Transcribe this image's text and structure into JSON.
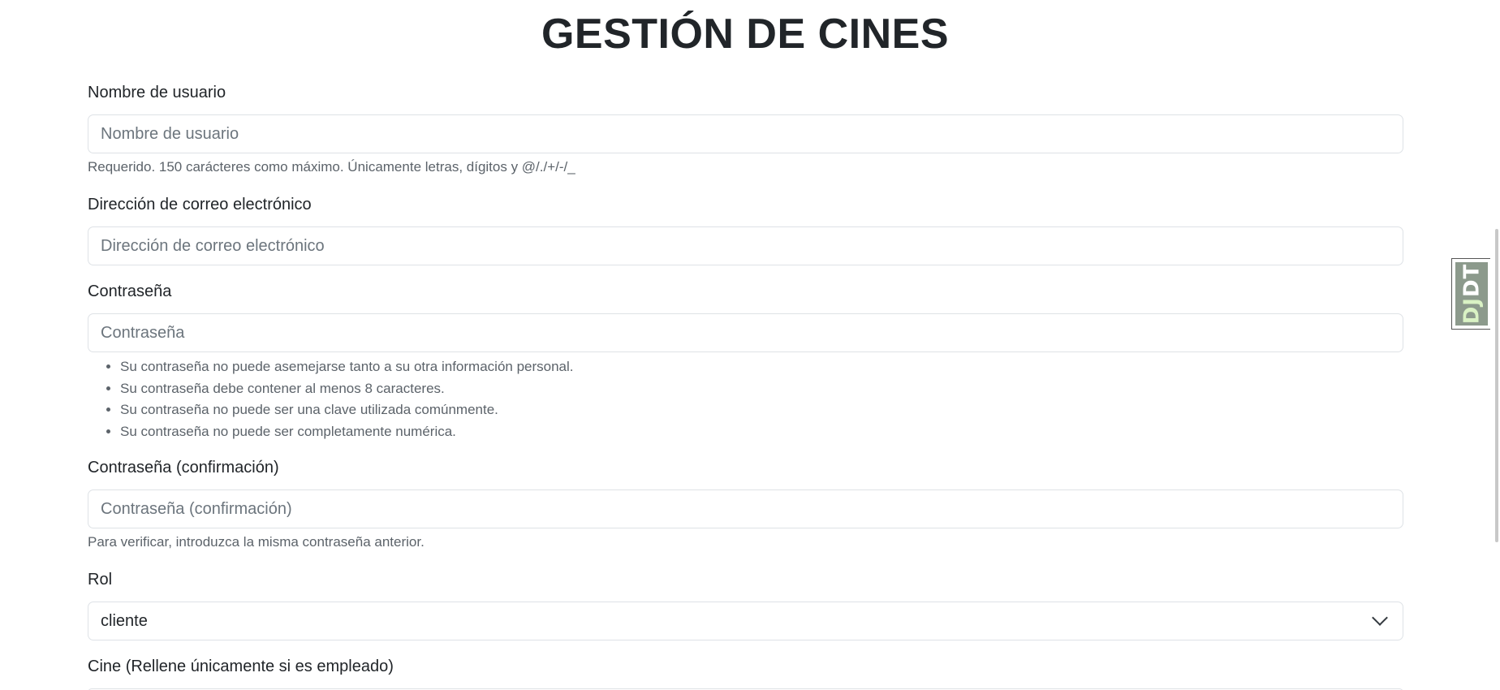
{
  "page_title": "GESTIÓN DE CINES",
  "form": {
    "username": {
      "label": "Nombre de usuario",
      "placeholder": "Nombre de usuario",
      "value": "",
      "help": "Requerido. 150 carácteres como máximo. Únicamente letras, dígitos y @/./+/-/_"
    },
    "email": {
      "label": "Dirección de correo electrónico",
      "placeholder": "Dirección de correo electrónico",
      "value": ""
    },
    "password1": {
      "label": "Contraseña",
      "placeholder": "Contraseña",
      "value": "",
      "help_items": [
        "Su contraseña no puede asemejarse tanto a su otra información personal.",
        "Su contraseña debe contener al menos 8 caracteres.",
        "Su contraseña no puede ser una clave utilizada comúnmente.",
        "Su contraseña no puede ser completamente numérica."
      ]
    },
    "password2": {
      "label": "Contraseña (confirmación)",
      "placeholder": "Contraseña (confirmación)",
      "value": "",
      "help": "Para verificar, introduzca la misma contraseña anterior."
    },
    "role": {
      "label": "Rol",
      "selected": "cliente"
    },
    "cinema": {
      "label": "Cine (Rellene únicamente si es empleado)"
    }
  },
  "debug_toolbar": {
    "handle_dj": "DJ",
    "handle_dt": "DT"
  },
  "colors": {
    "border": "#dee2e6",
    "help_text": "#5c636a",
    "placeholder": "#6c757d",
    "text": "#212529",
    "djdt_handle": "#8c9a8c"
  }
}
